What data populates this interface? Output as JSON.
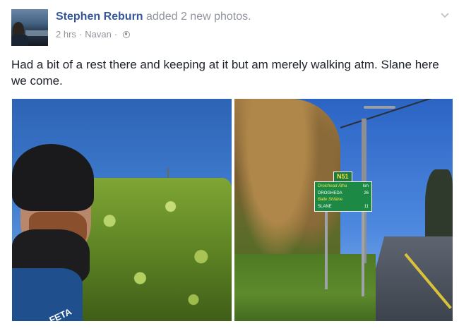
{
  "post": {
    "author": "Stephen Reburn",
    "action": "added 2 new photos.",
    "time": "2 hrs",
    "separator": "·",
    "location": "Navan",
    "text": "Had a bit of a rest there and keeping at it but am merely walking atm. Slane here we come."
  },
  "photos": [
    {
      "jacket_text": "FETA"
    },
    {
      "sign": {
        "route": "N51",
        "rows": [
          {
            "place_irish": "Droichead Átha",
            "place": "DROGHEDA",
            "distance": "26"
          },
          {
            "place_irish": "Baile Shláine",
            "place": "SLANE",
            "distance": "11"
          }
        ]
      }
    }
  ],
  "icons": {
    "avatar": "profile-photo",
    "audience": "globe-icon",
    "menu": "chevron-down-icon"
  },
  "colors": {
    "link": "#365899",
    "meta": "#90949c",
    "text": "#1d2129"
  }
}
